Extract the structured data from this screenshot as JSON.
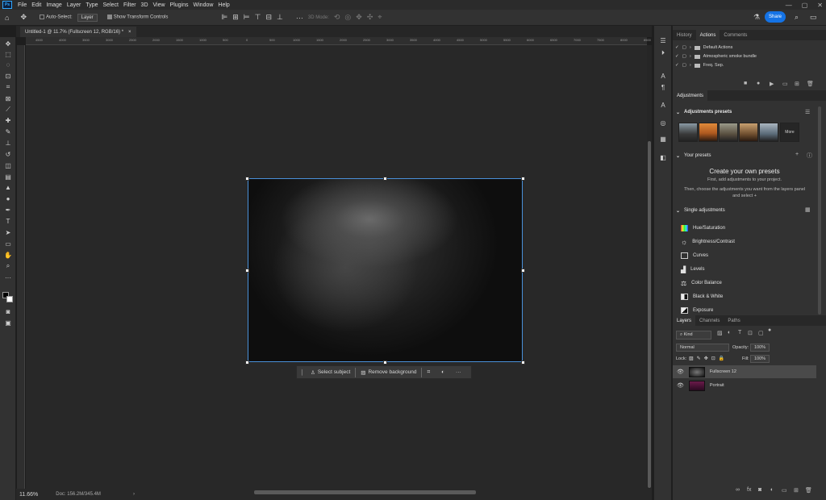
{
  "app": {
    "logo": "Ps"
  },
  "menu": [
    "File",
    "Edit",
    "Image",
    "Layer",
    "Type",
    "Select",
    "Filter",
    "3D",
    "View",
    "Plugins",
    "Window",
    "Help"
  ],
  "window_controls": {
    "minimize": "—",
    "maximize": "▢",
    "close": "✕"
  },
  "options_bar": {
    "auto_select_label": "Auto-Select:",
    "auto_select_value": "Layer",
    "show_transform_label": "Show Transform Controls",
    "mode_3d_label": "3D Mode:",
    "share_label": "Share"
  },
  "document_tab": {
    "title": "Untitled-1 @ 11.7% (Fullscreen 12, RGB/16) *",
    "close": "×"
  },
  "ruler_h_labels": [
    "4500",
    "4000",
    "3500",
    "3000",
    "2500",
    "2000",
    "1500",
    "1000",
    "500",
    "0",
    "500",
    "1000",
    "1500",
    "2000",
    "2500",
    "3000",
    "3500",
    "4000",
    "4500",
    "5000",
    "5500",
    "6000",
    "6500",
    "7000",
    "7500",
    "8000",
    "8500"
  ],
  "context_bar": {
    "select_subject": "Select subject",
    "remove_background": "Remove background",
    "more": "···"
  },
  "status": {
    "zoom": "11.66%",
    "doc": "Doc: 156.2M/345.4M"
  },
  "actions_panel": {
    "tabs": [
      "History",
      "Actions",
      "Comments"
    ],
    "active_tab": "Actions",
    "items": [
      {
        "label": "Default Actions"
      },
      {
        "label": "Atmospheric smoke bundle"
      },
      {
        "label": "Freq. Sep."
      }
    ]
  },
  "adjustments_panel": {
    "tab": "Adjustments",
    "presets_header": "Adjustments presets",
    "more_label": "More",
    "your_presets_header": "Your presets",
    "create_title": "Create your own presets",
    "create_line1": "First, add adjustments to your project.",
    "create_line2": "Then, choose the adjustments you want from the layers panel",
    "create_line3": "and select",
    "single_header": "Single adjustments",
    "single": [
      "Hue/Saturation",
      "Brightness/Contrast",
      "Curves",
      "Levels",
      "Color Balance",
      "Black & White",
      "Exposure"
    ]
  },
  "layers_panel": {
    "tabs": [
      "Layers",
      "Channels",
      "Paths"
    ],
    "active_tab": "Layers",
    "kind_label": "Kind",
    "blend_mode": "Normal",
    "opacity_label": "Opacity:",
    "opacity_value": "100%",
    "lock_label": "Lock:",
    "fill_label": "Fill:",
    "fill_value": "100%",
    "layers": [
      {
        "name": "Fullscreen 12",
        "selected": true
      },
      {
        "name": "Portrait",
        "selected": false
      }
    ]
  },
  "colors": {
    "accent": "#1473e6",
    "panel": "#323232",
    "canvas": "#282828"
  }
}
